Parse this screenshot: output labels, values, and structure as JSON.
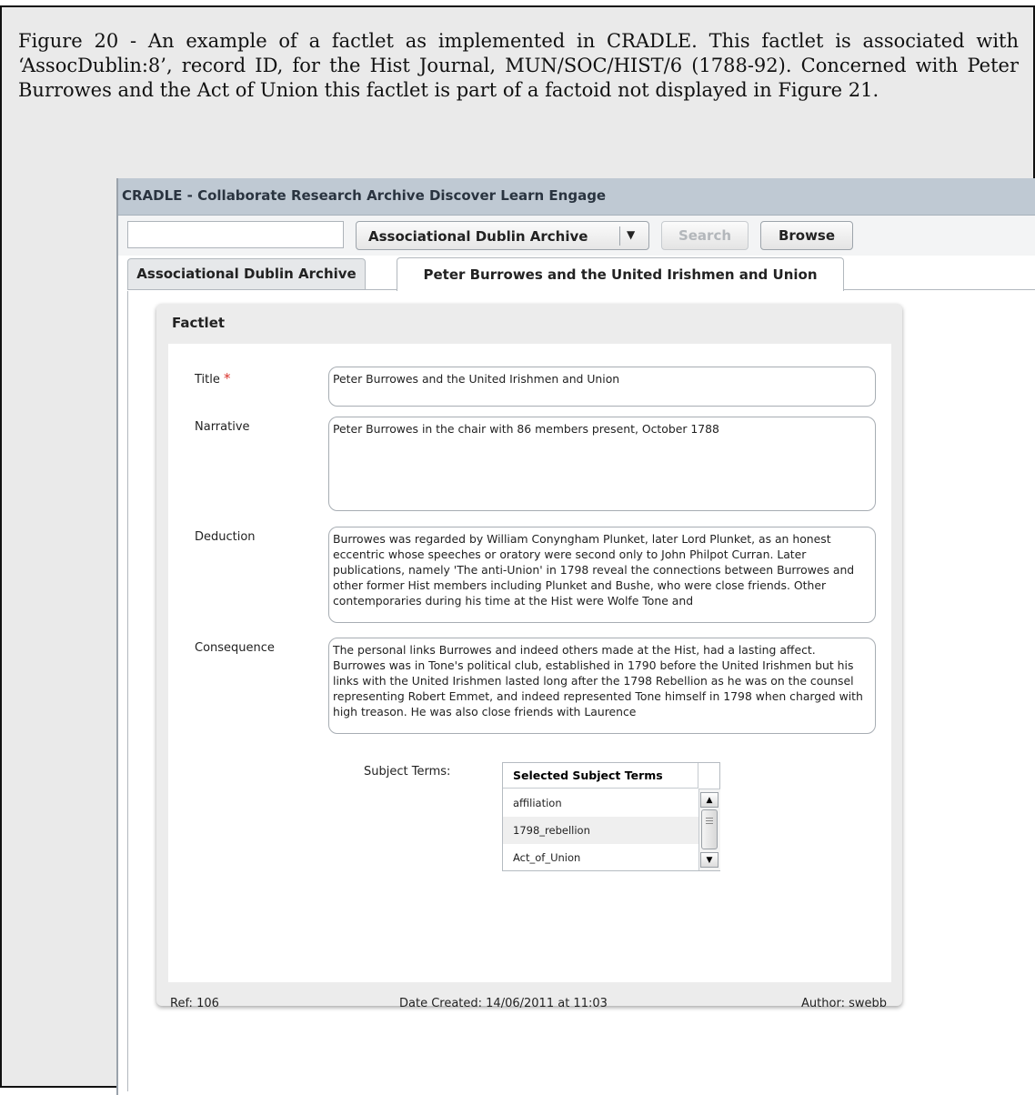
{
  "caption": "Figure 20 - An example of a factlet as implemented in CRADLE. This factlet is associated with ‘AssocDublin:8’, record ID, for the Hist Journal, MUN/SOC/HIST/6 (1788-92). Concerned with Peter Burrowes and the Act of Union this factlet is part of a factoid not displayed in Figure 21.",
  "app": {
    "title": "CRADLE - Collaborate Research Archive Discover Learn Engage"
  },
  "search": {
    "value": "",
    "archive_select": "Associational Dublin Archive",
    "search_label": "Search",
    "browse_label": "Browse"
  },
  "tabs": [
    {
      "label": "Associational Dublin Archive"
    },
    {
      "label": "Peter Burrowes and the United Irishmen and Union"
    }
  ],
  "factlet": {
    "heading": "Factlet",
    "required_mark": "*",
    "fields": {
      "title": {
        "label": "Title",
        "value": "Peter Burrowes and the United Irishmen and Union"
      },
      "narrative": {
        "label": "Narrative",
        "value": "Peter Burrowes in the chair with 86 members present, October 1788"
      },
      "deduction": {
        "label": "Deduction",
        "value": "Burrowes was regarded by William Conyngham Plunket, later Lord Plunket, as an honest eccentric whose speeches or oratory were second only to John Philpot Curran. Later publications, namely 'The anti-Union' in 1798 reveal the connections between Burrowes and other former Hist members including Plunket and Bushe, who were close friends. Other contemporaries during his time at the Hist were Wolfe Tone and"
      },
      "consequence": {
        "label": "Consequence",
        "value": "The personal links Burrowes and indeed others made at the Hist, had a lasting affect. Burrowes was in Tone's political club, established in 1790 before the United Irishmen but his links with the United Irishmen lasted long after the 1798 Rebellion as he was on the counsel representing Robert Emmet, and indeed represented Tone himself in 1798 when charged with high treason. He was also close friends with Laurence"
      }
    },
    "subject_terms_label": "Subject Terms:",
    "subject_terms_header": "Selected Subject Terms",
    "subject_terms": [
      "affiliation",
      "1798_rebellion",
      "Act_of_Union"
    ],
    "footer": {
      "ref": "Ref: 106",
      "date_created": "Date Created: 14/06/2011 at 11:03",
      "author": "Author: swebb"
    }
  }
}
